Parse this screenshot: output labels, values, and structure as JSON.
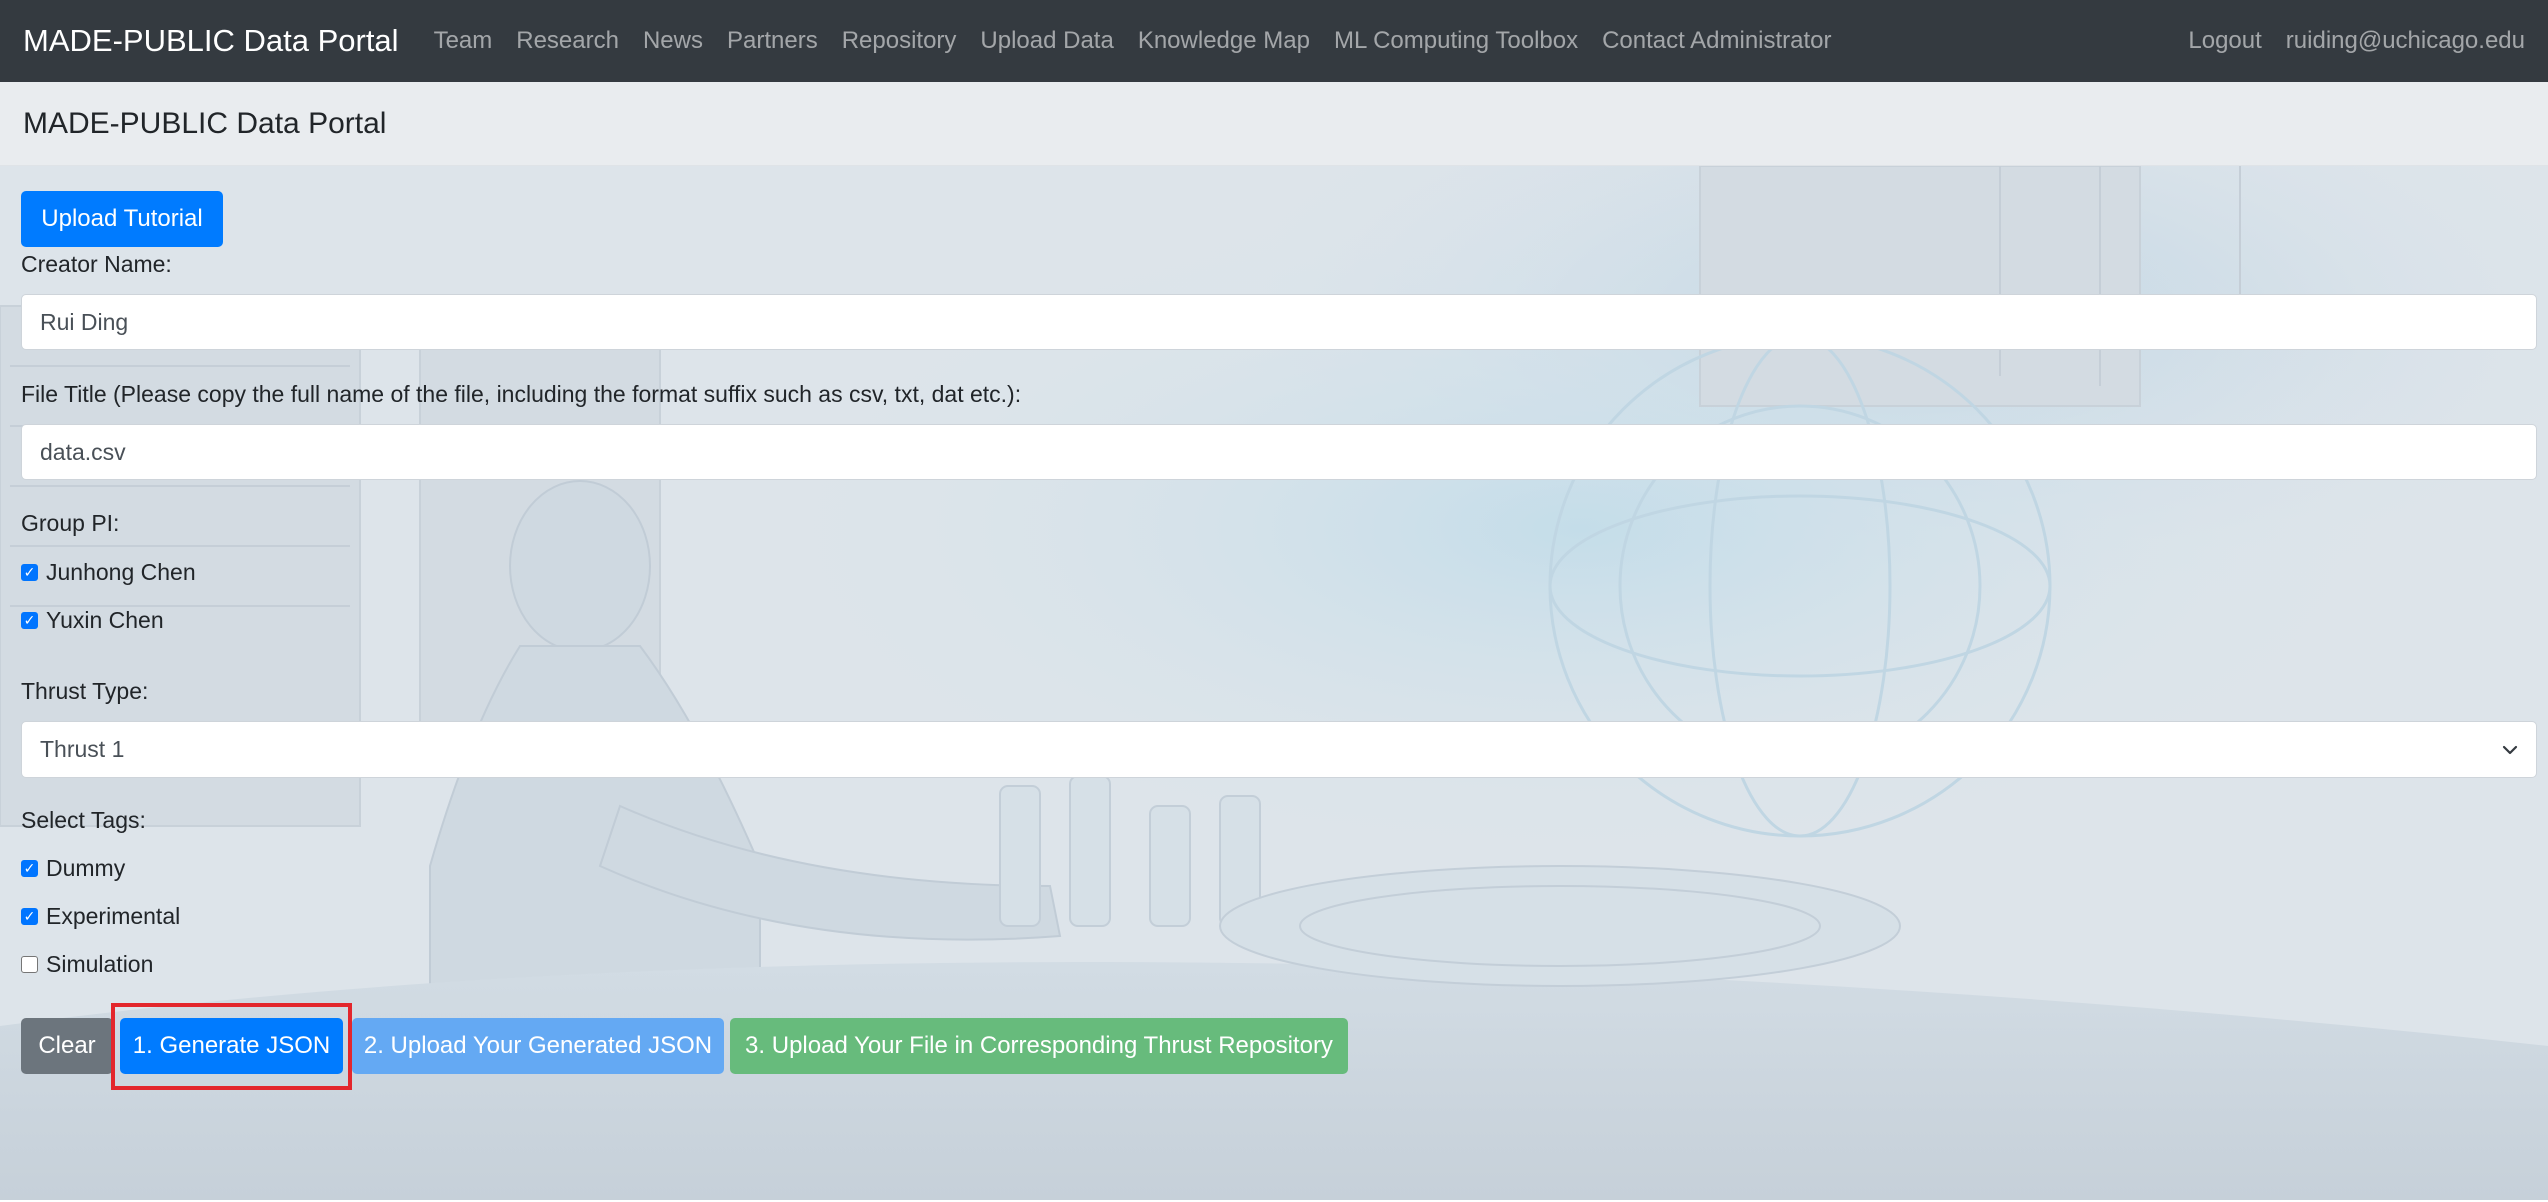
{
  "navbar": {
    "brand": "MADE-PUBLIC Data Portal",
    "links": [
      "Team",
      "Research",
      "News",
      "Partners",
      "Repository",
      "Upload Data",
      "Knowledge Map",
      "ML Computing Toolbox",
      "Contact Administrator"
    ],
    "right": {
      "logout": "Logout",
      "user": "ruiding@uchicago.edu"
    }
  },
  "header": {
    "title": "MADE-PUBLIC Data Portal"
  },
  "form": {
    "tutorial_button": "Upload Tutorial",
    "creator": {
      "label": "Creator Name:",
      "value": "Rui Ding"
    },
    "file_title": {
      "label": "File Title (Please copy the full name of the file, including the format suffix such as csv, txt, dat etc.):",
      "value": "data.csv"
    },
    "group_pi": {
      "label": "Group PI:",
      "options": [
        {
          "label": "Junhong Chen",
          "checked": true
        },
        {
          "label": "Yuxin Chen",
          "checked": true
        }
      ]
    },
    "thrust": {
      "label": "Thrust Type:",
      "selected": "Thrust 1"
    },
    "tags": {
      "label": "Select Tags:",
      "options": [
        {
          "label": "Dummy",
          "checked": true
        },
        {
          "label": "Experimental",
          "checked": true
        },
        {
          "label": "Simulation",
          "checked": false
        }
      ]
    },
    "actions": {
      "clear": "Clear",
      "generate": "1. Generate JSON",
      "upload_json": "2. Upload Your Generated JSON",
      "upload_file": "3. Upload Your File in Corresponding Thrust Repository"
    }
  },
  "colors": {
    "navbar_bg": "#343a40",
    "primary": "#007bff",
    "info": "#64a9f3",
    "success": "#67bb7c",
    "secondary": "#6c757d",
    "highlight": "#e3262c"
  },
  "icons": {
    "select_arrow": "chevron-down-icon",
    "checkbox_mark": "check-icon"
  }
}
